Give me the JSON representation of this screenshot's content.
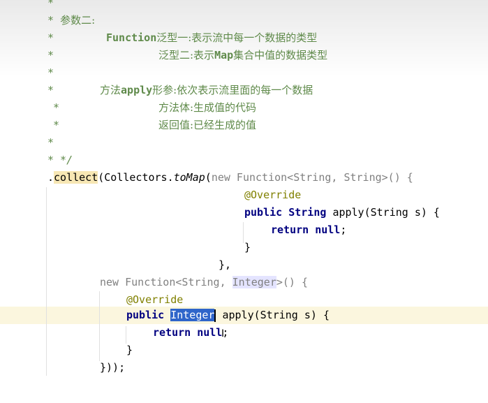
{
  "comments": {
    "star": "*",
    "star_colon": "* ",
    "l2_label": "参数二:",
    "l3_prefix": "Function",
    "l3_text": "泛型一:表示流中每一个数据的类型",
    "l4_text": "泛型二:表示",
    "l4_map": "Map",
    "l4_rest": "集合中值的数据类型",
    "l6_prefix": "方法",
    "l6_apply": "apply",
    "l6_rest": "形参:依次表示流里面的每一个数据",
    "l7_text": "方法体:生成值的代码",
    "l8_text": "返回值:已经生成的值",
    "l10_end": "* */"
  },
  "code": {
    "dot": ".",
    "collect": "collect",
    "collectors": "(Collectors.",
    "tomap": "toMap",
    "open_paren": "(",
    "new": "new",
    "function_generic": " Function<String, String>() {",
    "override": "@Override",
    "public": "public",
    "string_type": " String ",
    "apply_sig": "apply(String s) {",
    "return": "return",
    "null": " null",
    "semi": ";",
    "close_brace": "}",
    "close_brace_comma": "},",
    "new2": "new",
    "function2_a": " Function<String, ",
    "integer": "Integer",
    "function2_b": ">() {",
    "override2": "@Override",
    "public2": "public",
    "integer_sel": "Integer",
    "apply_sig2": " apply(String s) {",
    "return2": "return",
    "null2": " null",
    "semi2": ";",
    "close_brace2": "}",
    "close_all": "}));"
  }
}
